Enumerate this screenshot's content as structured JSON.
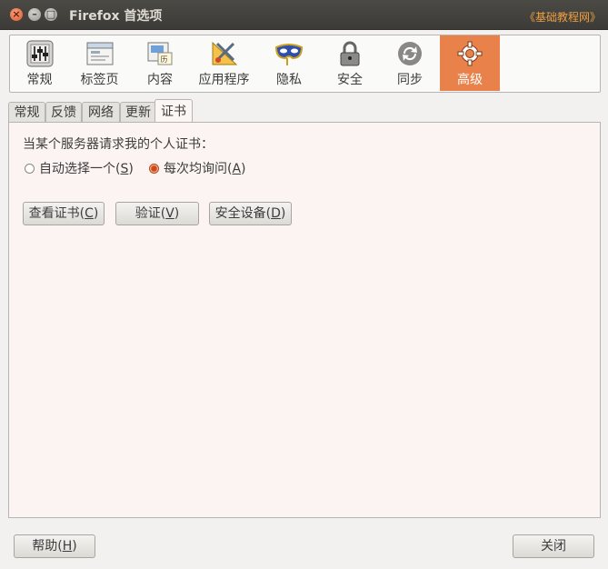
{
  "window": {
    "title": "Firefox 首选项",
    "watermark": "《基础教程网》"
  },
  "toolbar": {
    "items": [
      {
        "label": "常规",
        "icon": "sliders-icon"
      },
      {
        "label": "标签页",
        "icon": "tabs-icon"
      },
      {
        "label": "内容",
        "icon": "content-icon"
      },
      {
        "label": "应用程序",
        "icon": "applications-icon"
      },
      {
        "label": "隐私",
        "icon": "mask-icon"
      },
      {
        "label": "安全",
        "icon": "padlock-icon"
      },
      {
        "label": "同步",
        "icon": "sync-icon"
      },
      {
        "label": "高级",
        "icon": "gear-icon",
        "active": true
      }
    ],
    "accent_color": "#e8814a"
  },
  "subtabs": [
    "常规",
    "反馈",
    "网络",
    "更新",
    "证书"
  ],
  "certificates": {
    "prompt": "当某个服务器请求我的个人证书：",
    "radio_auto": {
      "text": "自动选择一个(",
      "key": "S",
      "end": ")"
    },
    "radio_ask": {
      "text": "每次均询问(",
      "key": "A",
      "end": ")"
    },
    "btn_view": {
      "text": "查看证书(",
      "key": "C",
      "end": ")"
    },
    "btn_validate": {
      "text": "验证(",
      "key": "V",
      "end": ")"
    },
    "btn_devices": {
      "text": "安全设备(",
      "key": "D",
      "end": ")"
    }
  },
  "footer": {
    "help": {
      "text": "帮助(",
      "key": "H",
      "end": ")"
    },
    "close": "关闭"
  }
}
